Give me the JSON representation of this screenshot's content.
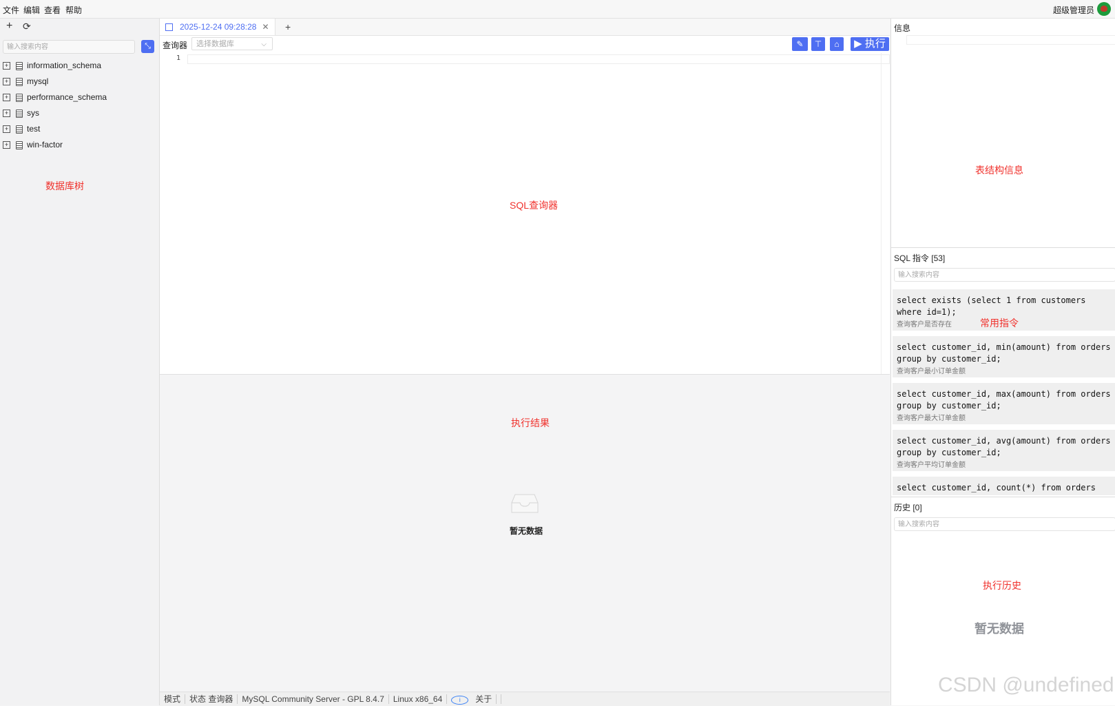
{
  "menubar": {
    "items": [
      "文件",
      "编辑",
      "查看",
      "帮助"
    ],
    "user": "超级管理员"
  },
  "sidebar": {
    "search_placeholder": "输入搜索内容",
    "databases": [
      "information_schema",
      "mysql",
      "performance_schema",
      "sys",
      "test",
      "win-factor"
    ],
    "annotation": "数据库树"
  },
  "editor": {
    "tab_label": "2025-12-24 09:28:28",
    "query_label": "查询器",
    "db_select_placeholder": "选择数据库",
    "run_label": "执行",
    "line_number": "1",
    "annotation": "SQL查询器"
  },
  "results": {
    "annotation": "执行结果",
    "empty_text": "暂无数据"
  },
  "statusbar": {
    "mode": "模式",
    "state": "状态 查询器",
    "server": "MySQL Community Server - GPL 8.4.7",
    "platform": "Linux x86_64",
    "about": "关于"
  },
  "right": {
    "info_title": "信息",
    "info_annotation": "表结构信息",
    "commands_title": "SQL 指令 [53]",
    "commands_search_placeholder": "输入搜索内容",
    "commands_annotation": "常用指令",
    "commands": [
      {
        "sql": "select exists (select 1 from customers\nwhere id=1);",
        "desc": "查询客户是否存在"
      },
      {
        "sql": "select customer_id, min(amount) from orders\ngroup by customer_id;",
        "desc": "查询客户最小订单金额"
      },
      {
        "sql": "select customer_id, max(amount) from orders\ngroup by customer_id;",
        "desc": "查询客户最大订单金额"
      },
      {
        "sql": "select customer_id, avg(amount) from orders\ngroup by customer_id;",
        "desc": "查询客户平均订单金额"
      },
      {
        "sql": "select customer_id, count(*) from orders",
        "desc": ""
      }
    ],
    "history_title": "历史 [0]",
    "history_search_placeholder": "输入搜索内容",
    "history_annotation": "执行历史",
    "history_empty": "暂无数据"
  },
  "watermark": "CSDN @undefined",
  "colors": {
    "accent": "#4e6ef2",
    "annotation": "#f0312c"
  }
}
